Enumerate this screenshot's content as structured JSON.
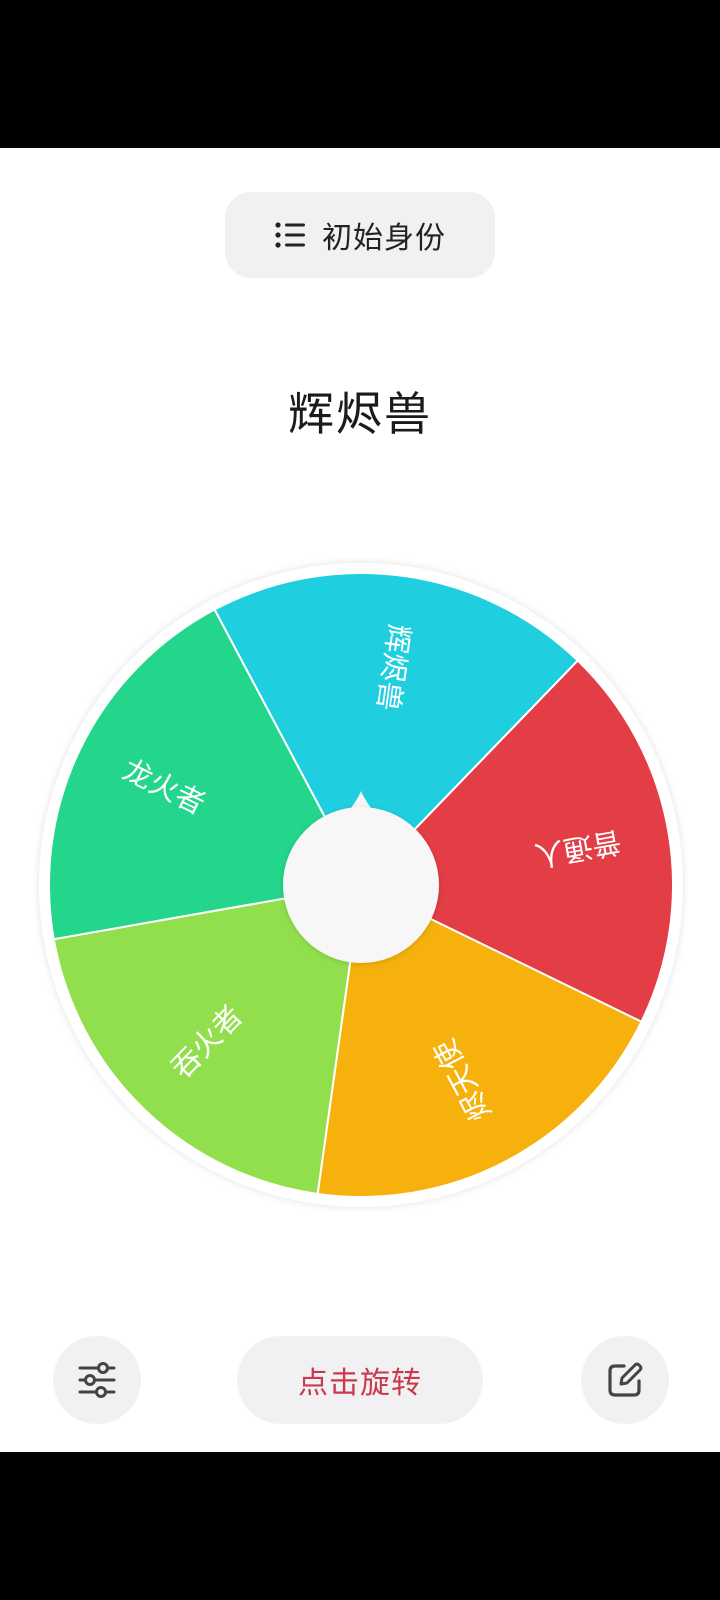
{
  "header": {
    "mode_label": "初始身份",
    "mode_icon": "list-icon"
  },
  "result": {
    "text": "辉烬兽"
  },
  "wheel": {
    "segments": [
      {
        "label": "辉烬兽",
        "color": "#1fcfe0"
      },
      {
        "label": "普通人",
        "color": "#e33d45"
      },
      {
        "label": "烬天使",
        "color": "#f6b10c"
      },
      {
        "label": "吞火者",
        "color": "#92df4d"
      },
      {
        "label": "龙火者",
        "color": "#24d68b"
      }
    ],
    "pointer_icon": "pointer-icon"
  },
  "footer": {
    "settings_icon": "sliders-icon",
    "spin_label": "点击旋转",
    "edit_icon": "edit-icon"
  }
}
